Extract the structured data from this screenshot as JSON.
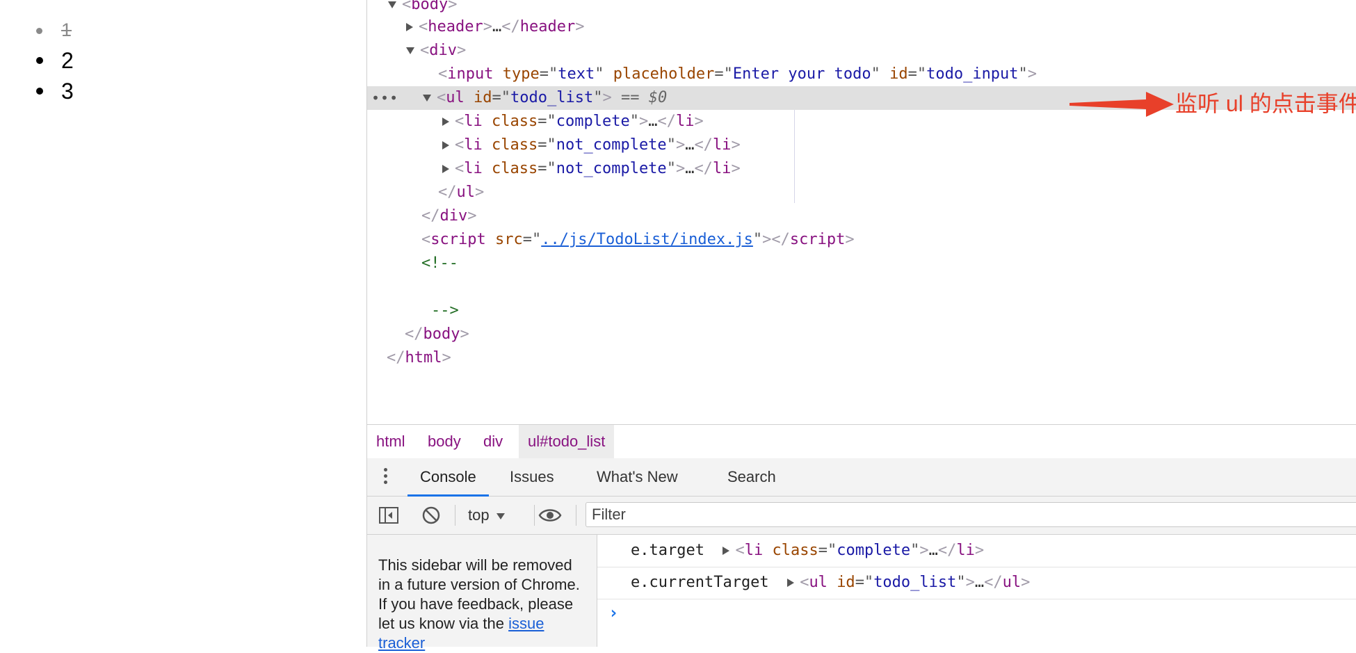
{
  "page": {
    "todo_items": [
      {
        "text": "1",
        "state": "complete"
      },
      {
        "text": "2",
        "state": "not_complete"
      },
      {
        "text": "3",
        "state": "not_complete"
      }
    ]
  },
  "elements": {
    "lines": {
      "body_open": "body",
      "header": {
        "tag": "header",
        "close": "header"
      },
      "div_open": "div",
      "input": {
        "tag": "input",
        "type_attr": "type",
        "type_val": "text",
        "ph_attr": "placeholder",
        "ph_val": "Enter your todo",
        "id_attr": "id",
        "id_val": "todo_input"
      },
      "ul": {
        "tag": "ul",
        "id_attr": "id",
        "id_val": "todo_list",
        "marker": "== $0"
      },
      "li1": {
        "tag": "li",
        "class_attr": "class",
        "class_val": "complete"
      },
      "li2": {
        "tag": "li",
        "class_attr": "class",
        "class_val": "not_complete"
      },
      "li3": {
        "tag": "li",
        "class_attr": "class",
        "class_val": "not_complete"
      },
      "ul_close": "ul",
      "div_close": "div",
      "script": {
        "tag": "script",
        "src_attr": "src",
        "src_val": "../js/TodoList/index.js"
      },
      "comment_open": "<!--",
      "comment_close": "-->",
      "body_close": "body",
      "html_close": "html"
    },
    "ellipsis": "…",
    "row_dots": "•••"
  },
  "annotation": {
    "text": "监听 ul 的点击事件",
    "color": "#e8402a"
  },
  "breadcrumbs": [
    "html",
    "body",
    "div",
    "ul#todo_list"
  ],
  "drawer": {
    "tabs": [
      "Console",
      "Issues",
      "What's New",
      "Search"
    ],
    "active_tab": "Console"
  },
  "console_toolbar": {
    "context": "top",
    "filter_placeholder": "Filter"
  },
  "console_sidebar": {
    "message": "This sidebar will be removed in a future version of Chrome. If you have feedback, please let us know via the ",
    "link": "issue tracker"
  },
  "console": {
    "messages": [
      {
        "label": "e.target",
        "tag": "li",
        "attr": "class",
        "value": "complete"
      },
      {
        "label": "e.currentTarget",
        "tag": "ul",
        "attr": "id",
        "value": "todo_list"
      }
    ],
    "prompt": "›"
  },
  "colors": {
    "tag": "#881280",
    "attr_name": "#994500",
    "attr_value": "#1a1aa6",
    "comment": "#236e25",
    "selection": "#e0e0e0",
    "accent": "#1a73e8"
  }
}
